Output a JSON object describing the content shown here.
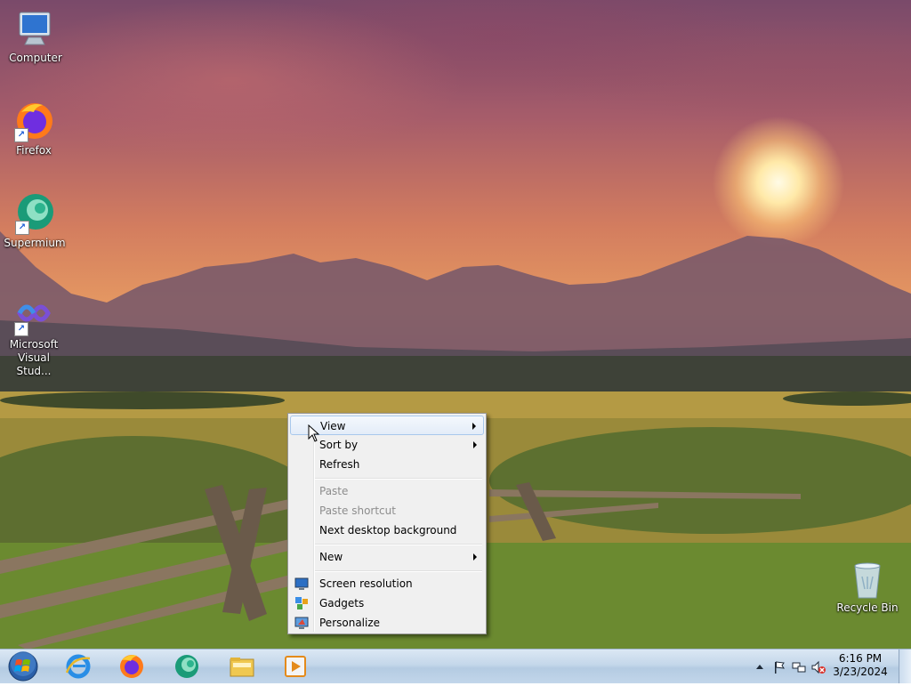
{
  "desktop_icons": [
    {
      "id": "computer",
      "label": "Computer",
      "icon": "computer-icon",
      "shortcut": false
    },
    {
      "id": "firefox",
      "label": "Firefox",
      "icon": "firefox-icon",
      "shortcut": true
    },
    {
      "id": "supermium",
      "label": "Supermium",
      "icon": "supermium-icon",
      "shortcut": true
    },
    {
      "id": "vs",
      "label": "Microsoft Visual Stud...",
      "label_line1": "Microsoft",
      "label_line2": "Visual Stud...",
      "icon": "visual-studio-icon",
      "shortcut": true
    },
    {
      "id": "recycle",
      "label": "Recycle Bin",
      "icon": "recycle-bin-icon",
      "shortcut": false
    }
  ],
  "context_menu": {
    "items": [
      {
        "label": "View",
        "submenu": true,
        "disabled": false,
        "highlighted": true
      },
      {
        "label": "Sort by",
        "submenu": true,
        "disabled": false
      },
      {
        "label": "Refresh",
        "submenu": false,
        "disabled": false
      },
      {
        "label": "Paste",
        "submenu": false,
        "disabled": true
      },
      {
        "label": "Paste shortcut",
        "submenu": false,
        "disabled": true
      },
      {
        "label": "Next desktop background",
        "submenu": false,
        "disabled": false
      },
      {
        "label": "New",
        "submenu": true,
        "disabled": false
      },
      {
        "label": "Screen resolution",
        "submenu": false,
        "disabled": false,
        "icon": "monitor-icon"
      },
      {
        "label": "Gadgets",
        "submenu": false,
        "disabled": false,
        "icon": "gadgets-icon"
      },
      {
        "label": "Personalize",
        "submenu": false,
        "disabled": false,
        "icon": "personalize-icon"
      }
    ]
  },
  "taskbar": {
    "pinned": [
      {
        "name": "internet-explorer",
        "icon": "internet-explorer-icon"
      },
      {
        "name": "firefox",
        "icon": "firefox-icon"
      },
      {
        "name": "supermium",
        "icon": "supermium-icon"
      },
      {
        "name": "windows-explorer",
        "icon": "folder-icon"
      },
      {
        "name": "media-player",
        "icon": "media-player-icon"
      }
    ],
    "tray_icons": [
      "show-hidden-icons",
      "action-center-flag-icon",
      "network-icon",
      "volume-muted-icon"
    ],
    "clock": {
      "time": "6:16 PM",
      "date": "3/23/2024"
    }
  },
  "colors": {
    "menu_bg": "#f0f0f0",
    "menu_hover_border": "#a8c8ec",
    "taskbar_top": "#dbe8f4",
    "disabled_text": "#8d8d8d"
  }
}
